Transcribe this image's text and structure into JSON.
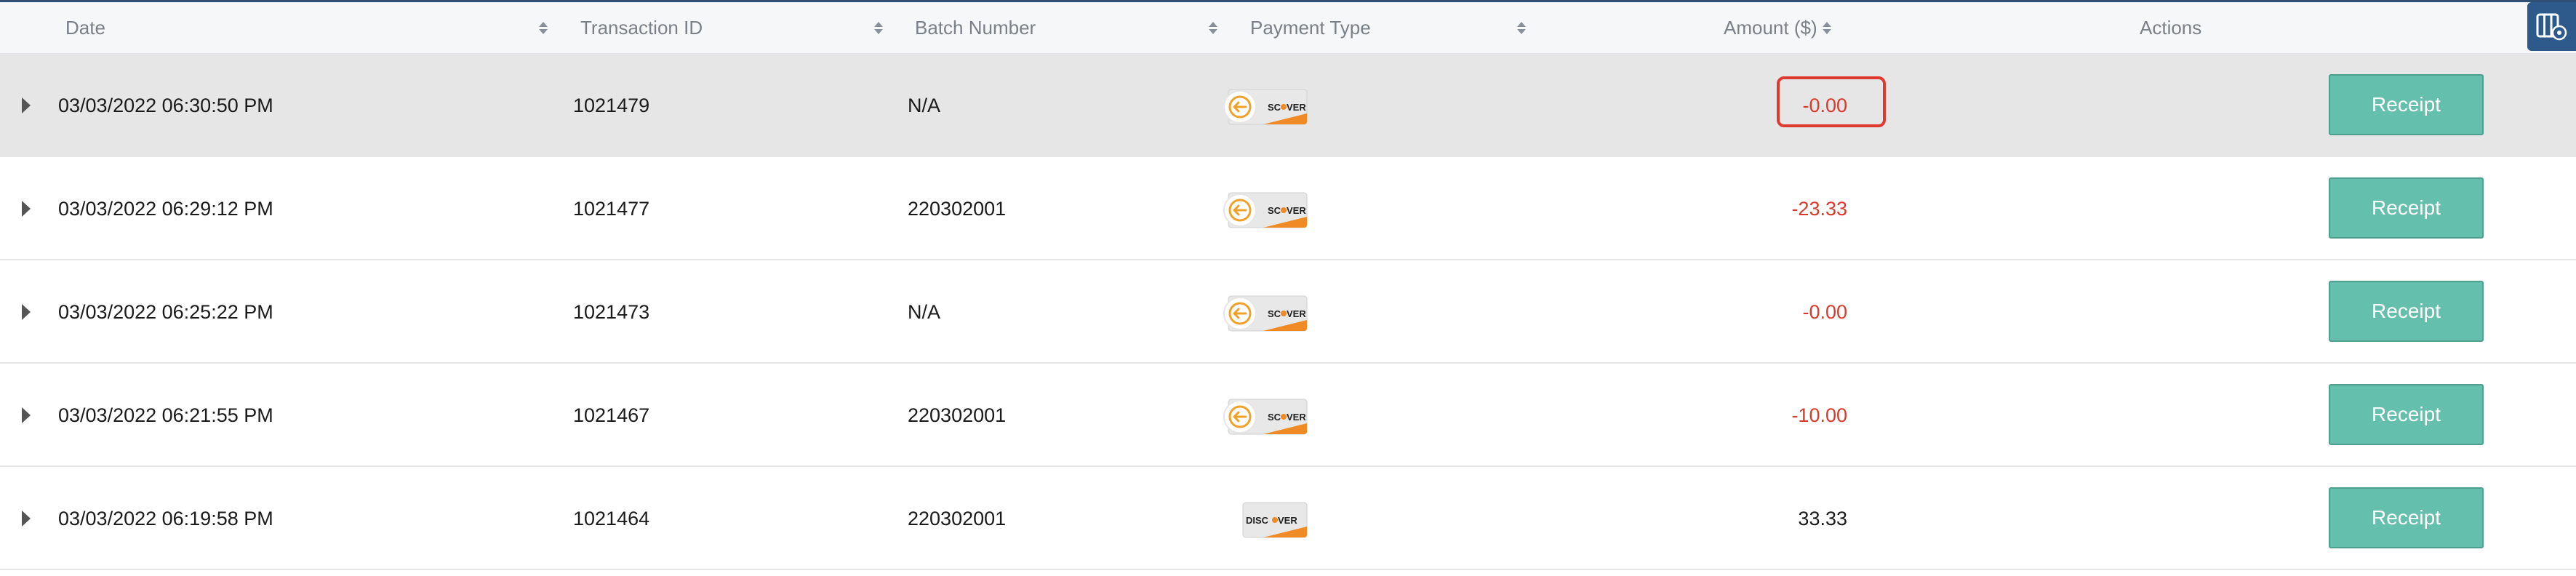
{
  "table": {
    "columns": [
      {
        "key": "date",
        "label": "Date",
        "sortable": true
      },
      {
        "key": "transaction_id",
        "label": "Transaction ID",
        "sortable": true
      },
      {
        "key": "batch_number",
        "label": "Batch Number",
        "sortable": true
      },
      {
        "key": "payment_type",
        "label": "Payment Type",
        "sortable": true
      },
      {
        "key": "amount",
        "label": "Amount ($)",
        "sortable": true
      },
      {
        "key": "actions",
        "label": "Actions",
        "sortable": false
      }
    ],
    "rows": [
      {
        "date": "03/03/2022 06:30:50 PM",
        "transaction_id": "1021479",
        "batch_number": "N/A",
        "payment_type": "discover-refund-card",
        "amount": "-0.00",
        "amount_negative": true,
        "action": "Receipt",
        "highlighted": true
      },
      {
        "date": "03/03/2022 06:29:12 PM",
        "transaction_id": "1021477",
        "batch_number": "220302001",
        "payment_type": "discover-refund-card",
        "amount": "-23.33",
        "amount_negative": true,
        "action": "Receipt",
        "highlighted": false
      },
      {
        "date": "03/03/2022 06:25:22 PM",
        "transaction_id": "1021473",
        "batch_number": "N/A",
        "payment_type": "discover-refund-card",
        "amount": "-0.00",
        "amount_negative": true,
        "action": "Receipt",
        "highlighted": false
      },
      {
        "date": "03/03/2022 06:21:55 PM",
        "transaction_id": "1021467",
        "batch_number": "220302001",
        "payment_type": "discover-refund-card",
        "amount": "-10.00",
        "amount_negative": true,
        "action": "Receipt",
        "highlighted": false
      },
      {
        "date": "03/03/2022 06:19:58 PM",
        "transaction_id": "1021464",
        "batch_number": "220302001",
        "payment_type": "discover-card",
        "amount": "33.33",
        "amount_negative": false,
        "action": "Receipt",
        "highlighted": false
      }
    ]
  },
  "icons": {
    "column_settings": "column-settings-icon",
    "row_expander": "caret-right-icon",
    "sort": "sort-icon",
    "refund": "refund-arrow-icon"
  },
  "colors": {
    "header_bg": "#f6f7f9",
    "highlight_row_bg": "#e6e6e6",
    "negative_amount": "#d93a2b",
    "receipt_button": "#64bfad",
    "callout_border": "#e0392d",
    "column_settings_bg": "#2d5a8a",
    "discover_orange": "#f08a24"
  }
}
